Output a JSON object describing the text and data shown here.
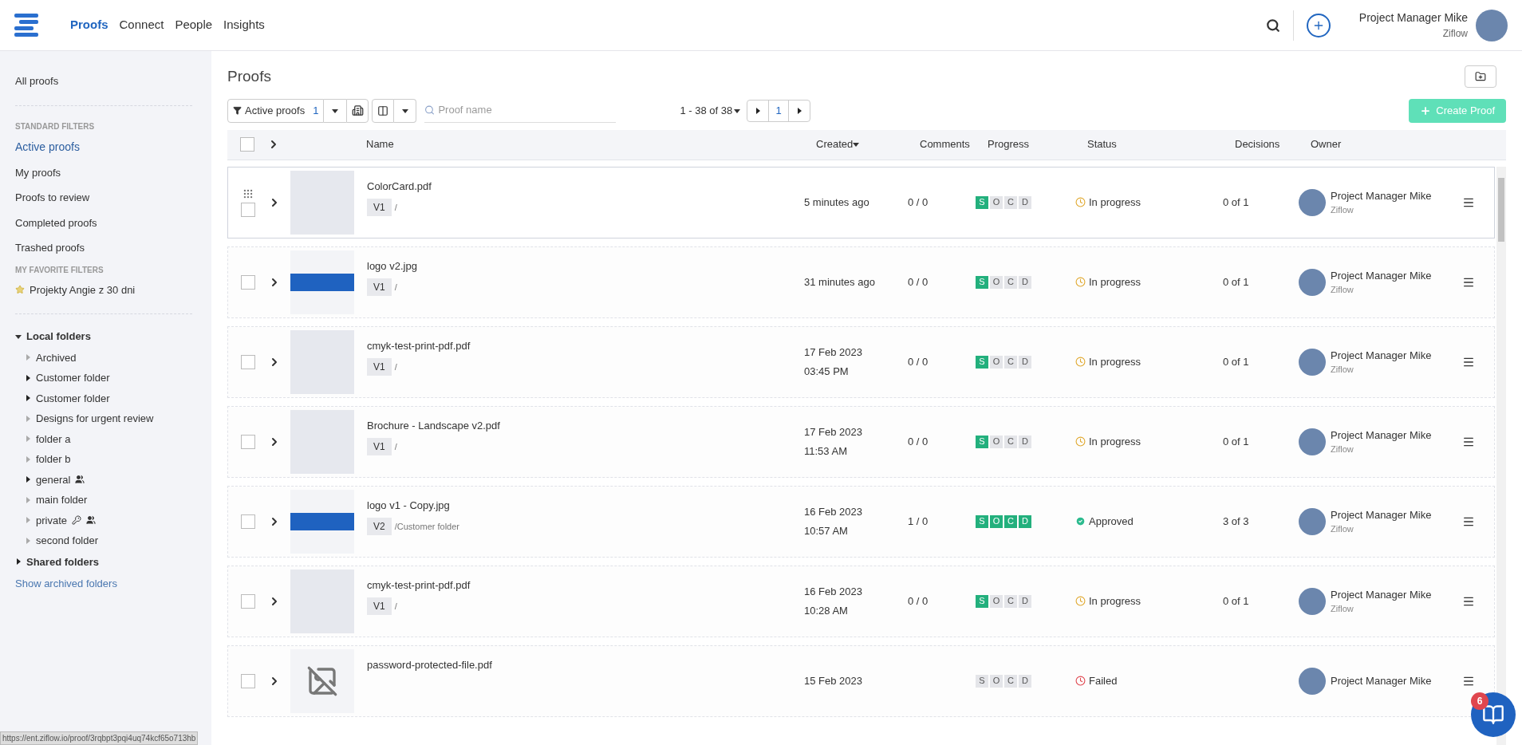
{
  "nav": {
    "tabs": [
      {
        "label": "Proofs",
        "selected": true
      },
      {
        "label": "Connect",
        "selected": false
      },
      {
        "label": "People",
        "selected": false
      },
      {
        "label": "Insights",
        "selected": false
      }
    ],
    "user": {
      "name": "Project Manager Mike",
      "org": "Ziflow"
    }
  },
  "sidebar": {
    "items": [
      {
        "kind": "link",
        "label": "All proofs",
        "selected": false
      },
      {
        "kind": "divider"
      },
      {
        "kind": "heading",
        "label": "STANDARD FILTERS"
      },
      {
        "kind": "link",
        "label": "Active proofs",
        "selected": true
      },
      {
        "kind": "link",
        "label": "My proofs",
        "selected": false
      },
      {
        "kind": "link",
        "label": "Proofs to review",
        "selected": false
      },
      {
        "kind": "link",
        "label": "Completed proofs",
        "selected": false
      },
      {
        "kind": "link",
        "label": "Trashed proofs",
        "selected": false
      },
      {
        "kind": "heading",
        "label": "MY FAVORITE FILTERS"
      },
      {
        "kind": "favorite",
        "label": "Projekty Angie z 30 dni"
      },
      {
        "kind": "divider"
      }
    ],
    "folders": [
      {
        "label": "Local folders",
        "expanded": true,
        "children": [
          {
            "label": "Archived",
            "has_children": false
          },
          {
            "label": "Customer folder",
            "has_children": true
          },
          {
            "label": "Customer folder",
            "has_children": true
          },
          {
            "label": "Designs for urgent review",
            "has_children": false
          },
          {
            "label": "folder a",
            "has_children": false
          },
          {
            "label": "folder b",
            "has_children": false
          },
          {
            "label": "general",
            "has_children": true,
            "shared": true
          },
          {
            "label": "main folder",
            "has_children": false
          },
          {
            "label": "private",
            "has_children": false,
            "locked": true,
            "shared": true
          },
          {
            "label": "second folder",
            "has_children": false
          }
        ]
      },
      {
        "label": "Shared folders",
        "expanded": false
      }
    ],
    "show_archived": "Show archived folders"
  },
  "page": {
    "title": "Proofs",
    "filter": {
      "label": "Active proofs",
      "count": "1"
    },
    "search": {
      "placeholder": "Proof name"
    },
    "pagination": {
      "range": "1 - 38 of 38",
      "page": "1"
    },
    "create_button": "Create Proof"
  },
  "table": {
    "all_selected": false,
    "columns": [
      "Name",
      "Created",
      "Comments",
      "Progress",
      "Status",
      "Decisions",
      "Owner"
    ],
    "rows": [
      {
        "kind": "image",
        "selected": false,
        "name": "ColorCard.pdf",
        "version": "V1",
        "folder": "/",
        "created": [
          "5 minutes ago"
        ],
        "comments": "0 / 0",
        "steps": [
          {
            "label": "S",
            "done": true
          },
          {
            "label": "O",
            "done": false
          },
          {
            "label": "C",
            "done": false
          },
          {
            "label": "D",
            "done": false
          }
        ],
        "status": {
          "kind": "in_progress",
          "label": "In progress"
        },
        "decisions": "0 of 1",
        "owner": "Project Manager Mike",
        "org": "Ziflow",
        "hovered": true
      },
      {
        "kind": "banner",
        "selected": false,
        "name": "logo v2.jpg",
        "version": "V1",
        "folder": "/",
        "created": [
          "31 minutes ago"
        ],
        "comments": "0 / 0",
        "steps": [
          {
            "label": "S",
            "done": true
          },
          {
            "label": "O",
            "done": false
          },
          {
            "label": "C",
            "done": false
          },
          {
            "label": "D",
            "done": false
          }
        ],
        "status": {
          "kind": "in_progress",
          "label": "In progress"
        },
        "decisions": "0 of 1",
        "owner": "Project Manager Mike",
        "org": "Ziflow",
        "hovered": false
      },
      {
        "kind": "image",
        "selected": false,
        "name": "cmyk-test-print-pdf.pdf",
        "version": "V1",
        "folder": "/",
        "created": [
          "17 Feb 2023",
          "03:45 PM"
        ],
        "comments": "0 / 0",
        "steps": [
          {
            "label": "S",
            "done": true
          },
          {
            "label": "O",
            "done": false
          },
          {
            "label": "C",
            "done": false
          },
          {
            "label": "D",
            "done": false
          }
        ],
        "status": {
          "kind": "in_progress",
          "label": "In progress"
        },
        "decisions": "0 of 1",
        "owner": "Project Manager Mike",
        "org": "Ziflow",
        "hovered": false
      },
      {
        "kind": "image",
        "selected": false,
        "name": "Brochure - Landscape v2.pdf",
        "version": "V1",
        "folder": "/",
        "created": [
          "17 Feb 2023",
          "11:53 AM"
        ],
        "comments": "0 / 0",
        "steps": [
          {
            "label": "S",
            "done": true
          },
          {
            "label": "O",
            "done": false
          },
          {
            "label": "C",
            "done": false
          },
          {
            "label": "D",
            "done": false
          }
        ],
        "status": {
          "kind": "in_progress",
          "label": "In progress"
        },
        "decisions": "0 of 1",
        "owner": "Project Manager Mike",
        "org": "Ziflow",
        "hovered": false
      },
      {
        "kind": "banner",
        "selected": false,
        "name": "logo v1 - Copy.jpg",
        "version": "V2",
        "folder": "/Customer folder",
        "created": [
          "16 Feb 2023",
          "10:57 AM"
        ],
        "comments": "1 / 0",
        "steps": [
          {
            "label": "S",
            "done": true
          },
          {
            "label": "O",
            "done": true
          },
          {
            "label": "C",
            "done": true
          },
          {
            "label": "D",
            "done": true
          }
        ],
        "status": {
          "kind": "approved",
          "label": "Approved"
        },
        "decisions": "3 of 3",
        "owner": "Project Manager Mike",
        "org": "Ziflow",
        "hovered": false
      },
      {
        "kind": "image",
        "selected": false,
        "name": "cmyk-test-print-pdf.pdf",
        "version": "V1",
        "folder": "/",
        "created": [
          "16 Feb 2023",
          "10:28 AM"
        ],
        "comments": "0 / 0",
        "steps": [
          {
            "label": "S",
            "done": true
          },
          {
            "label": "O",
            "done": false
          },
          {
            "label": "C",
            "done": false
          },
          {
            "label": "D",
            "done": false
          }
        ],
        "status": {
          "kind": "in_progress",
          "label": "In progress"
        },
        "decisions": "0 of 1",
        "owner": "Project Manager Mike",
        "org": "Ziflow",
        "hovered": false
      },
      {
        "kind": "missing",
        "selected": false,
        "name": "password-protected-file.pdf",
        "created": [
          "15 Feb 2023"
        ],
        "steps": [
          {
            "label": "S",
            "done": false
          },
          {
            "label": "O",
            "done": false
          },
          {
            "label": "C",
            "done": false
          },
          {
            "label": "D",
            "done": false
          }
        ],
        "status": {
          "kind": "failed",
          "label": "Failed"
        },
        "owner": "Project Manager Mike",
        "hovered": false
      }
    ]
  },
  "status_url": "https://ent.ziflow.io/proof/3rqbpt3pqi4uq74kcf65o713hb",
  "help": {
    "badge": "6"
  }
}
